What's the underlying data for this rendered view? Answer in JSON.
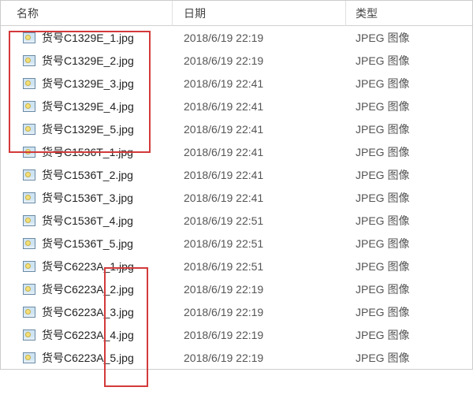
{
  "header": {
    "name": "名称",
    "date": "日期",
    "type": "类型"
  },
  "file_type_label": "JPEG 图像",
  "files": [
    {
      "name": "货号C1329E_1.jpg",
      "date": "2018/6/19 22:19",
      "type": "JPEG 图像"
    },
    {
      "name": "货号C1329E_2.jpg",
      "date": "2018/6/19 22:19",
      "type": "JPEG 图像"
    },
    {
      "name": "货号C1329E_3.jpg",
      "date": "2018/6/19 22:41",
      "type": "JPEG 图像"
    },
    {
      "name": "货号C1329E_4.jpg",
      "date": "2018/6/19 22:41",
      "type": "JPEG 图像"
    },
    {
      "name": "货号C1329E_5.jpg",
      "date": "2018/6/19 22:41",
      "type": "JPEG 图像"
    },
    {
      "name": "货号C1536T_1.jpg",
      "date": "2018/6/19 22:41",
      "type": "JPEG 图像"
    },
    {
      "name": "货号C1536T_2.jpg",
      "date": "2018/6/19 22:41",
      "type": "JPEG 图像"
    },
    {
      "name": "货号C1536T_3.jpg",
      "date": "2018/6/19 22:41",
      "type": "JPEG 图像"
    },
    {
      "name": "货号C1536T_4.jpg",
      "date": "2018/6/19 22:51",
      "type": "JPEG 图像"
    },
    {
      "name": "货号C1536T_5.jpg",
      "date": "2018/6/19 22:51",
      "type": "JPEG 图像"
    },
    {
      "name": "货号C6223A_1.jpg",
      "date": "2018/6/19 22:51",
      "type": "JPEG 图像"
    },
    {
      "name": "货号C6223A_2.jpg",
      "date": "2018/6/19 22:19",
      "type": "JPEG 图像"
    },
    {
      "name": "货号C6223A_3.jpg",
      "date": "2018/6/19 22:19",
      "type": "JPEG 图像"
    },
    {
      "name": "货号C6223A_4.jpg",
      "date": "2018/6/19 22:19",
      "type": "JPEG 图像"
    },
    {
      "name": "货号C6223A_5.jpg",
      "date": "2018/6/19 22:19",
      "type": "JPEG 图像"
    }
  ]
}
